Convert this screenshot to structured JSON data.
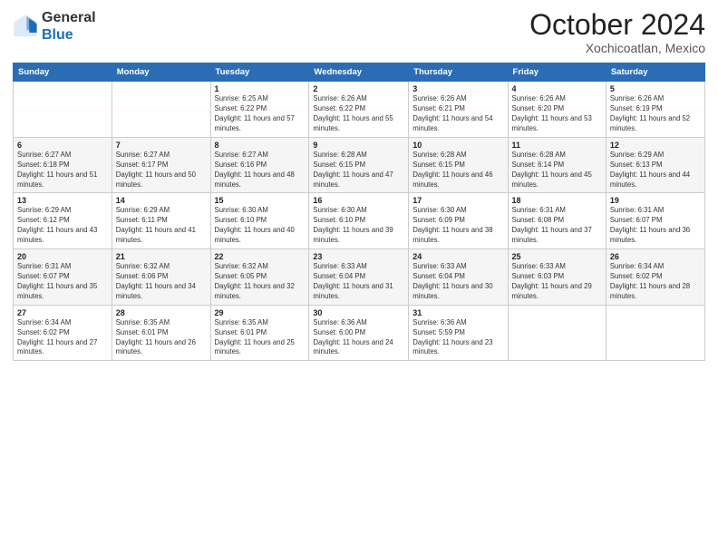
{
  "logo": {
    "line1": "General",
    "line2": "Blue"
  },
  "title": "October 2024",
  "location": "Xochicoatlan, Mexico",
  "days_of_week": [
    "Sunday",
    "Monday",
    "Tuesday",
    "Wednesday",
    "Thursday",
    "Friday",
    "Saturday"
  ],
  "weeks": [
    [
      {
        "day": "",
        "info": ""
      },
      {
        "day": "",
        "info": ""
      },
      {
        "day": "1",
        "info": "Sunrise: 6:25 AM\nSunset: 6:22 PM\nDaylight: 11 hours and 57 minutes."
      },
      {
        "day": "2",
        "info": "Sunrise: 6:26 AM\nSunset: 6:22 PM\nDaylight: 11 hours and 55 minutes."
      },
      {
        "day": "3",
        "info": "Sunrise: 6:26 AM\nSunset: 6:21 PM\nDaylight: 11 hours and 54 minutes."
      },
      {
        "day": "4",
        "info": "Sunrise: 6:26 AM\nSunset: 6:20 PM\nDaylight: 11 hours and 53 minutes."
      },
      {
        "day": "5",
        "info": "Sunrise: 6:26 AM\nSunset: 6:19 PM\nDaylight: 11 hours and 52 minutes."
      }
    ],
    [
      {
        "day": "6",
        "info": "Sunrise: 6:27 AM\nSunset: 6:18 PM\nDaylight: 11 hours and 51 minutes."
      },
      {
        "day": "7",
        "info": "Sunrise: 6:27 AM\nSunset: 6:17 PM\nDaylight: 11 hours and 50 minutes."
      },
      {
        "day": "8",
        "info": "Sunrise: 6:27 AM\nSunset: 6:16 PM\nDaylight: 11 hours and 48 minutes."
      },
      {
        "day": "9",
        "info": "Sunrise: 6:28 AM\nSunset: 6:15 PM\nDaylight: 11 hours and 47 minutes."
      },
      {
        "day": "10",
        "info": "Sunrise: 6:28 AM\nSunset: 6:15 PM\nDaylight: 11 hours and 46 minutes."
      },
      {
        "day": "11",
        "info": "Sunrise: 6:28 AM\nSunset: 6:14 PM\nDaylight: 11 hours and 45 minutes."
      },
      {
        "day": "12",
        "info": "Sunrise: 6:29 AM\nSunset: 6:13 PM\nDaylight: 11 hours and 44 minutes."
      }
    ],
    [
      {
        "day": "13",
        "info": "Sunrise: 6:29 AM\nSunset: 6:12 PM\nDaylight: 11 hours and 43 minutes."
      },
      {
        "day": "14",
        "info": "Sunrise: 6:29 AM\nSunset: 6:11 PM\nDaylight: 11 hours and 41 minutes."
      },
      {
        "day": "15",
        "info": "Sunrise: 6:30 AM\nSunset: 6:10 PM\nDaylight: 11 hours and 40 minutes."
      },
      {
        "day": "16",
        "info": "Sunrise: 6:30 AM\nSunset: 6:10 PM\nDaylight: 11 hours and 39 minutes."
      },
      {
        "day": "17",
        "info": "Sunrise: 6:30 AM\nSunset: 6:09 PM\nDaylight: 11 hours and 38 minutes."
      },
      {
        "day": "18",
        "info": "Sunrise: 6:31 AM\nSunset: 6:08 PM\nDaylight: 11 hours and 37 minutes."
      },
      {
        "day": "19",
        "info": "Sunrise: 6:31 AM\nSunset: 6:07 PM\nDaylight: 11 hours and 36 minutes."
      }
    ],
    [
      {
        "day": "20",
        "info": "Sunrise: 6:31 AM\nSunset: 6:07 PM\nDaylight: 11 hours and 35 minutes."
      },
      {
        "day": "21",
        "info": "Sunrise: 6:32 AM\nSunset: 6:06 PM\nDaylight: 11 hours and 34 minutes."
      },
      {
        "day": "22",
        "info": "Sunrise: 6:32 AM\nSunset: 6:05 PM\nDaylight: 11 hours and 32 minutes."
      },
      {
        "day": "23",
        "info": "Sunrise: 6:33 AM\nSunset: 6:04 PM\nDaylight: 11 hours and 31 minutes."
      },
      {
        "day": "24",
        "info": "Sunrise: 6:33 AM\nSunset: 6:04 PM\nDaylight: 11 hours and 30 minutes."
      },
      {
        "day": "25",
        "info": "Sunrise: 6:33 AM\nSunset: 6:03 PM\nDaylight: 11 hours and 29 minutes."
      },
      {
        "day": "26",
        "info": "Sunrise: 6:34 AM\nSunset: 6:02 PM\nDaylight: 11 hours and 28 minutes."
      }
    ],
    [
      {
        "day": "27",
        "info": "Sunrise: 6:34 AM\nSunset: 6:02 PM\nDaylight: 11 hours and 27 minutes."
      },
      {
        "day": "28",
        "info": "Sunrise: 6:35 AM\nSunset: 6:01 PM\nDaylight: 11 hours and 26 minutes."
      },
      {
        "day": "29",
        "info": "Sunrise: 6:35 AM\nSunset: 6:01 PM\nDaylight: 11 hours and 25 minutes."
      },
      {
        "day": "30",
        "info": "Sunrise: 6:36 AM\nSunset: 6:00 PM\nDaylight: 11 hours and 24 minutes."
      },
      {
        "day": "31",
        "info": "Sunrise: 6:36 AM\nSunset: 5:59 PM\nDaylight: 11 hours and 23 minutes."
      },
      {
        "day": "",
        "info": ""
      },
      {
        "day": "",
        "info": ""
      }
    ]
  ]
}
